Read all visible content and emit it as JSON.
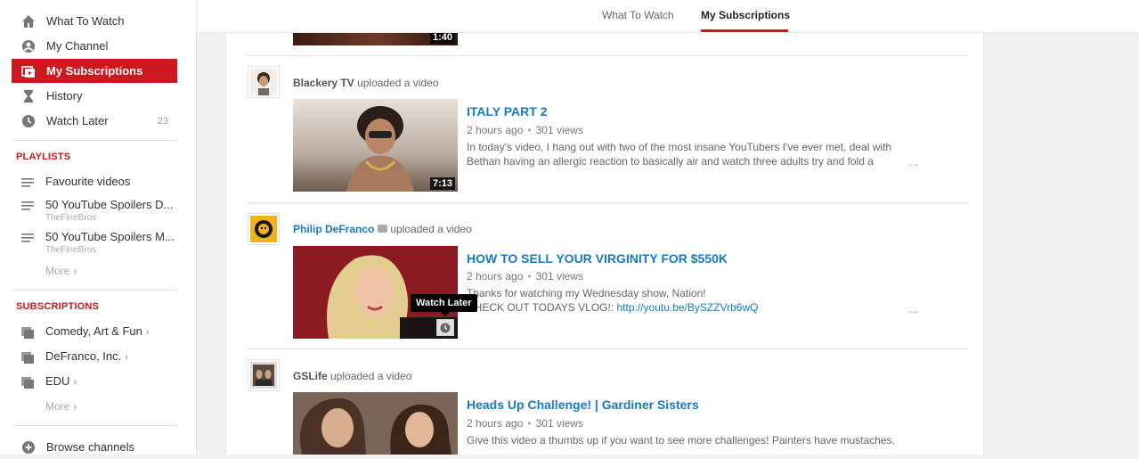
{
  "sidebar": {
    "main": [
      {
        "label": "What To Watch",
        "icon": "home-icon"
      },
      {
        "label": "My Channel",
        "icon": "user-icon"
      },
      {
        "label": "My Subscriptions",
        "icon": "subscriptions-icon",
        "active": true
      },
      {
        "label": "History",
        "icon": "hourglass-icon"
      },
      {
        "label": "Watch Later",
        "icon": "clock-icon",
        "count": "23"
      }
    ],
    "playlists_title": "PLAYLISTS",
    "playlists": [
      {
        "label": "Favourite videos",
        "owner": ""
      },
      {
        "label": "50 YouTube Spoilers D...",
        "owner": "TheFineBros"
      },
      {
        "label": "50 YouTube Spoilers M...",
        "owner": "TheFineBros"
      }
    ],
    "playlists_more": "More",
    "subscriptions_title": "SUBSCRIPTIONS",
    "subscriptions": [
      {
        "label": "Comedy, Art & Fun"
      },
      {
        "label": "DeFranco, Inc."
      },
      {
        "label": "EDU"
      }
    ],
    "subscriptions_more": "More",
    "browse": "Browse channels"
  },
  "tabs": [
    {
      "label": "What To Watch"
    },
    {
      "label": "My Subscriptions",
      "active": true
    }
  ],
  "feed": {
    "top_partial_duration": "1:40",
    "items": [
      {
        "channel": "Blackery TV",
        "action": "uploaded a video",
        "title": "ITALY PART 2",
        "age": "2 hours ago",
        "views": "301 views",
        "desc1": "In today's video, I hang out with two of the most insane YouTubers I've ever met, deal with",
        "desc2": "Bethan having an allergic reaction to basically air and watch three adults try and fold a",
        "duration": "7:13",
        "ellipsis": "..."
      },
      {
        "channel": "Philip DeFranco",
        "action": "uploaded a video",
        "title": "HOW TO SELL YOUR VIRGINITY FOR $550K",
        "age": "2 hours ago",
        "views": "301 views",
        "desc1": "Thanks for watching my Wednesday show, Nation!",
        "desc2_prefix": "CHECK OUT TODAYS VLOG!: ",
        "desc2_link": "http://youtu.be/BySZZVrb6wQ",
        "ellipsis": "...",
        "tooltip": "Watch Later"
      },
      {
        "channel": "GSLife",
        "action": "uploaded a video",
        "title": "Heads Up Challenge! | Gardiner Sisters",
        "age": "2 hours ago",
        "views": "301 views",
        "desc1": "Give this video a thumbs up if you want to see more challenges! Painters have mustaches."
      }
    ]
  },
  "colors": {
    "accent": "#cc181e",
    "link": "#167ac6"
  }
}
